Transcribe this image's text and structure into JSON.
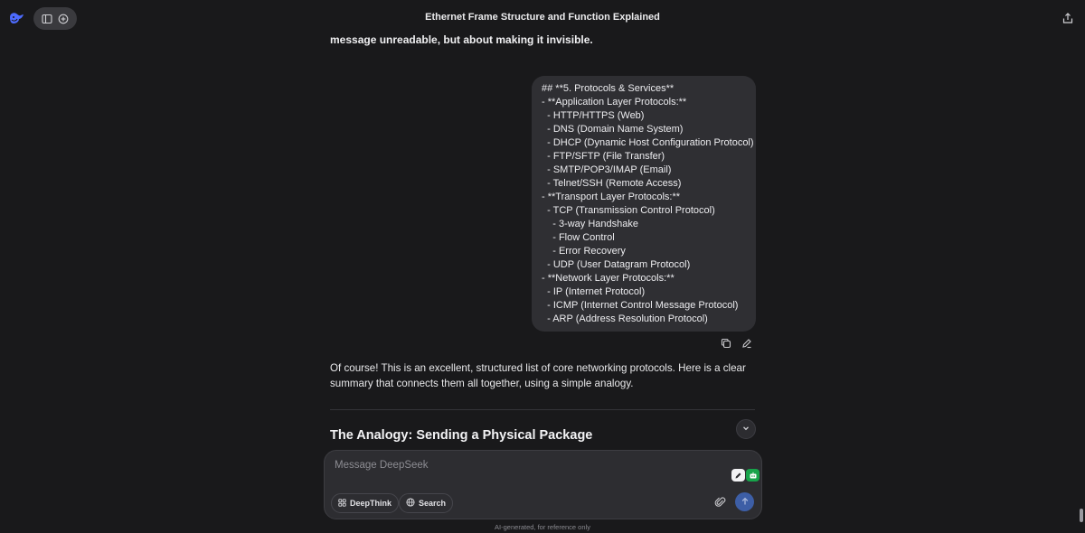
{
  "header": {
    "title": "Ethernet Frame Structure and Function Explained",
    "logo_icon": "deepseek-whale-icon",
    "sidebar_toggle_icon": "sidebar-toggle-icon",
    "new_chat_icon": "new-chat-icon",
    "share_icon": "share-icon"
  },
  "conversation": {
    "previous_text": "message unreadable, but about making it invisible.",
    "user_message": {
      "lines": [
        "## **5. Protocols & Services**",
        "- **Application Layer Protocols:**",
        "  - HTTP/HTTPS (Web)",
        "  - DNS (Domain Name System)",
        "  - DHCP (Dynamic Host Configuration Protocol)",
        "  - FTP/SFTP (File Transfer)",
        "  - SMTP/POP3/IMAP (Email)",
        "  - Telnet/SSH (Remote Access)",
        "- **Transport Layer Protocols:**",
        "  - TCP (Transmission Control Protocol)",
        "    - 3-way Handshake",
        "    - Flow Control",
        "    - Error Recovery",
        "  - UDP (User Datagram Protocol)",
        "- **Network Layer Protocols:**",
        "  - IP (Internet Protocol)",
        "  - ICMP (Internet Control Message Protocol)",
        "  - ARP (Address Resolution Protocol)"
      ]
    },
    "answer_text": "Of course! This is an excellent, structured list of core networking protocols. Here is a clear summary that connects them all together, using a simple analogy.",
    "answer_heading": "The Analogy: Sending a Physical Package"
  },
  "composer": {
    "placeholder": "Message DeepSeek",
    "deepthink_label": "DeepThink",
    "search_label": "Search"
  },
  "footer": {
    "disclaimer": "AI-generated, for reference only"
  },
  "colors": {
    "background": "#19191b",
    "bubble": "#2f2f33",
    "send_button": "#3d5ea6",
    "logo": "#4d6bfe"
  }
}
